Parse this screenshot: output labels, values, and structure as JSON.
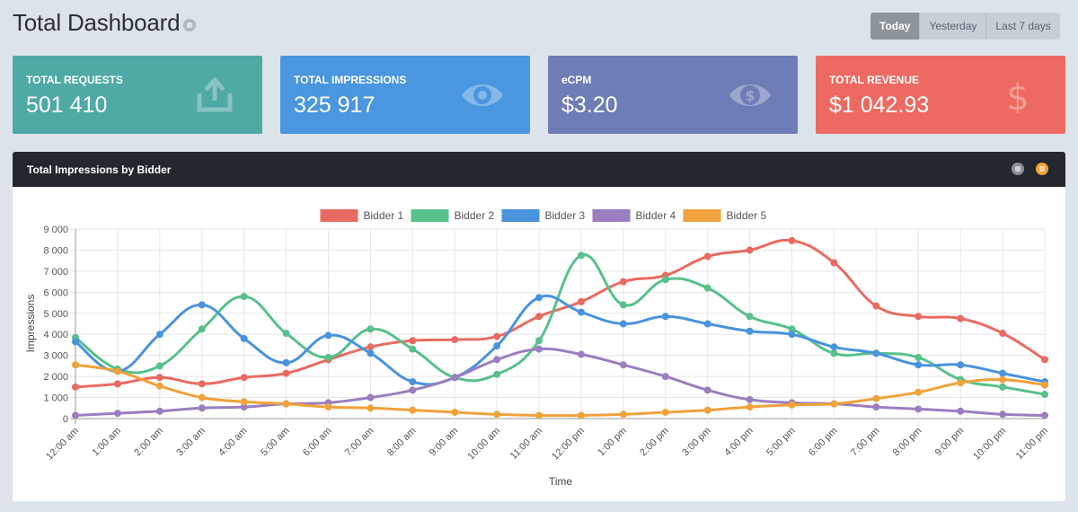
{
  "header": {
    "title": "Total Dashboard"
  },
  "date_range": {
    "options": [
      "Today",
      "Yesterday",
      "Last 7 days"
    ],
    "selected": "Today"
  },
  "stats": [
    {
      "label": "TOTAL REQUESTS",
      "value": "501 410",
      "color": "#4fa9a5",
      "icon": "upload-icon"
    },
    {
      "label": "TOTAL IMPRESSIONS",
      "value": "325 917",
      "color": "#4a96df",
      "icon": "eye-icon"
    },
    {
      "label": "eCPM",
      "value": "$3.20",
      "color": "#6f7db6",
      "icon": "eye-dollar-icon"
    },
    {
      "label": "TOTAL REVENUE",
      "value": "$1 042.93",
      "color": "#ec6a62",
      "icon": "dollar-icon"
    }
  ],
  "panel": {
    "title": "Total Impressions by Bidder",
    "controls": [
      "gray",
      "orange"
    ]
  },
  "chart_data": {
    "type": "line",
    "xlabel": "Time",
    "ylabel": "Impressions",
    "ylim": [
      0,
      9000
    ],
    "yticks": [
      "0",
      "1 000",
      "2 000",
      "3 000",
      "4 000",
      "5 000",
      "6 000",
      "7 000",
      "8 000",
      "9 000"
    ],
    "legend_position": "top",
    "grid": true,
    "categories": [
      "12:00 am",
      "1:00 am",
      "2:00 am",
      "3:00 am",
      "4:00 am",
      "5:00 am",
      "6:00 am",
      "7:00 am",
      "8:00 am",
      "9:00 am",
      "10:00 am",
      "11:00 am",
      "12:00 pm",
      "1:00 pm",
      "2:00 pm",
      "3:00 pm",
      "4:00 pm",
      "5:00 pm",
      "6:00 pm",
      "7:00 pm",
      "8:00 pm",
      "9:00 pm",
      "10:00 pm",
      "11:00 pm"
    ],
    "series": [
      {
        "name": "Bidder 1",
        "color": "#ea6a62",
        "values": [
          1500,
          1650,
          1950,
          1650,
          1950,
          2150,
          2800,
          3400,
          3700,
          3750,
          3900,
          4850,
          5550,
          6500,
          6800,
          7700,
          8000,
          8450,
          7400,
          5350,
          4850,
          4750,
          4050,
          2800
        ]
      },
      {
        "name": "Bidder 2",
        "color": "#58c08b",
        "values": [
          3850,
          2350,
          2500,
          4250,
          5800,
          4050,
          2900,
          4250,
          3300,
          1950,
          2100,
          3700,
          7750,
          5400,
          6600,
          6200,
          4850,
          4250,
          3100,
          3100,
          2900,
          1850,
          1500,
          1150
        ]
      },
      {
        "name": "Bidder 3",
        "color": "#4a93dd",
        "values": [
          3650,
          2250,
          4000,
          5400,
          3800,
          2650,
          3950,
          3100,
          1750,
          1950,
          3450,
          5750,
          5050,
          4500,
          4850,
          4500,
          4150,
          4000,
          3400,
          3100,
          2550,
          2550,
          2150,
          1750
        ]
      },
      {
        "name": "Bidder 4",
        "color": "#9b7ec0",
        "values": [
          150,
          250,
          350,
          500,
          550,
          700,
          750,
          1000,
          1350,
          1950,
          2800,
          3300,
          3050,
          2550,
          2000,
          1350,
          900,
          750,
          700,
          550,
          450,
          350,
          200,
          150
        ]
      },
      {
        "name": "Bidder 5",
        "color": "#f0a23b",
        "values": [
          2550,
          2250,
          1550,
          1000,
          800,
          700,
          550,
          500,
          400,
          300,
          200,
          150,
          150,
          200,
          300,
          400,
          550,
          650,
          700,
          950,
          1250,
          1700,
          1850,
          1600
        ]
      }
    ]
  }
}
